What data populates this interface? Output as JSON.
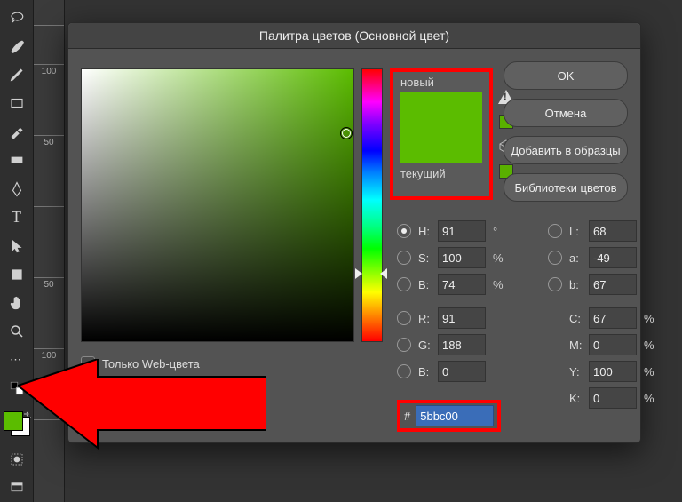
{
  "dialog": {
    "title": "Палитра цветов (Основной цвет)",
    "new_label": "новый",
    "current_label": "текущий",
    "buttons": {
      "ok": "OK",
      "cancel": "Отмена",
      "add": "Добавить в образцы",
      "libs": "Библиотеки цветов"
    },
    "web_only": "Только Web-цвета",
    "hsb": {
      "h": "91",
      "s": "100",
      "b": "74"
    },
    "rgb": {
      "r": "91",
      "g": "188",
      "b": "0"
    },
    "lab": {
      "l": "68",
      "a": "-49",
      "b": "67"
    },
    "cmyk": {
      "c": "67",
      "m": "0",
      "y": "100",
      "k": "0"
    },
    "hex": "5bbc00",
    "labels": {
      "h": "H:",
      "s": "S:",
      "bri": "B:",
      "r": "R:",
      "g": "G:",
      "blu": "B:",
      "l": "L:",
      "a": "a:",
      "bb": "b:",
      "c": "C:",
      "m": "M:",
      "y": "Y:",
      "k": "K:",
      "deg": "°",
      "pct": "%",
      "hash": "#"
    }
  },
  "ruler": {
    "t50": "50",
    "t100": "100",
    "t150": ""
  },
  "colors": {
    "current": "#5bbc00"
  }
}
